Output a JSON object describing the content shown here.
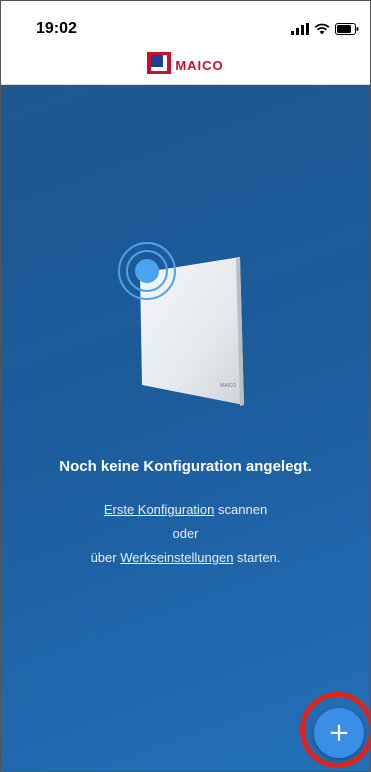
{
  "status_bar": {
    "time": "19:02",
    "icons": [
      "signal-icon",
      "wifi-icon",
      "battery-icon"
    ]
  },
  "header": {
    "logo_text": "MAICO",
    "brand_color": "#c8102e"
  },
  "empty_state": {
    "title": "Noch keine Konfiguration angelegt.",
    "line1_link": "Erste Konfiguration",
    "line1_rest": " scannen",
    "line2": "oder",
    "line3_prefix": "über ",
    "line3_link": "Werkseinstellungen",
    "line3_suffix": " starten.",
    "device_label": "MAICO"
  },
  "fab": {
    "icon": "plus-icon",
    "label": "+"
  },
  "colors": {
    "background_top": "#1f5791",
    "background_bottom": "#2370b8",
    "fab": "#3a8ee6",
    "highlight": "#e2231a"
  }
}
